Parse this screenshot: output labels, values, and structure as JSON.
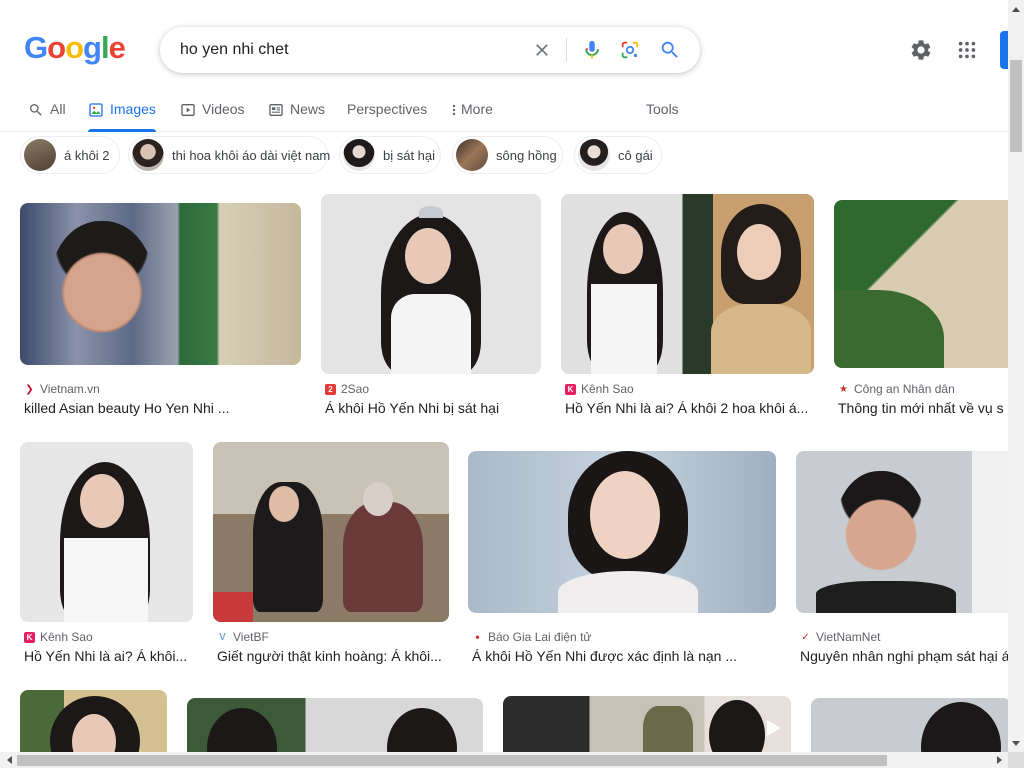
{
  "logo": {
    "letters": [
      "G",
      "o",
      "o",
      "g",
      "l",
      "e"
    ],
    "colors": [
      "#4285f4",
      "#ea4335",
      "#fbbc05",
      "#4285f4",
      "#34a853",
      "#ea4335"
    ]
  },
  "search": {
    "query": "ho yen nhi chet",
    "icons": {
      "clear": "close-icon",
      "voice": "mic-icon",
      "lens": "lens-icon",
      "submit": "search-icon"
    }
  },
  "header_icons": {
    "settings": "gear-icon",
    "apps": "apps-grid-icon"
  },
  "tabs": [
    {
      "label": "All",
      "icon": "search-icon",
      "active": false
    },
    {
      "label": "Images",
      "icon": "image-icon",
      "active": true
    },
    {
      "label": "Videos",
      "icon": "video-icon",
      "active": false
    },
    {
      "label": "News",
      "icon": "news-icon",
      "active": false
    },
    {
      "label": "Perspectives",
      "icon": "",
      "active": false
    },
    {
      "label": "More",
      "icon": "more-vert-icon",
      "active": false
    },
    {
      "label": "Tools",
      "icon": "",
      "active": false
    }
  ],
  "chips": [
    {
      "label": "á khôi 2",
      "thumb_color": "#6b5a48"
    },
    {
      "label": "thi hoa khôi áo dài việt nam",
      "thumb_color": "#a8958a"
    },
    {
      "label": "bị sát hại",
      "thumb_color": "#3c3a3c"
    },
    {
      "label": "sông hồng",
      "thumb_color": "#7c6048"
    },
    {
      "label": "cô gái",
      "thumb_color": "#d2cccc"
    }
  ],
  "results": [
    {
      "source": "Vietnam.vn",
      "title": "killed Asian beauty Ho Yen Nhi ...",
      "fav_color": "#c8102e",
      "fav_glyph": "❯"
    },
    {
      "source": "2Sao",
      "title": "Á khôi Hồ Yến Nhi bị sát hại",
      "fav_color": "#e53935",
      "fav_glyph": "2"
    },
    {
      "source": "Kênh Sao",
      "title": "Hồ Yến Nhi là ai? Á khôi 2 hoa khôi á...",
      "fav_color": "#e91e63",
      "fav_glyph": "K"
    },
    {
      "source": "Công an Nhân dân",
      "title": "Thông tin mới nhất về vụ s",
      "fav_color": "#c0392b",
      "fav_glyph": "★"
    },
    {
      "source": "Kênh Sao",
      "title": "Hồ Yến Nhi là ai? Á khôi...",
      "fav_color": "#e91e63",
      "fav_glyph": "K"
    },
    {
      "source": "VietBF",
      "title": "Giết người thật kinh hoàng: Á khôi...",
      "fav_color": "#7aa9d8",
      "fav_glyph": "V"
    },
    {
      "source": "Báo Gia Lai điện tử",
      "title": "Á khôi Hồ Yến Nhi được xác định là nạn ...",
      "fav_color": "#d32f2f",
      "fav_glyph": "•"
    },
    {
      "source": "VietNamNet",
      "title": "Nguyên nhân nghi phạm sát hại á",
      "fav_color": "#c62828",
      "fav_glyph": "✓"
    },
    {
      "source": "",
      "title": "",
      "fav_color": "",
      "fav_glyph": ""
    },
    {
      "source": "",
      "title": "",
      "fav_color": "",
      "fav_glyph": ""
    },
    {
      "source": "",
      "title": "",
      "fav_color": "",
      "fav_glyph": ""
    },
    {
      "source": "",
      "title": "",
      "fav_color": "",
      "fav_glyph": ""
    }
  ]
}
